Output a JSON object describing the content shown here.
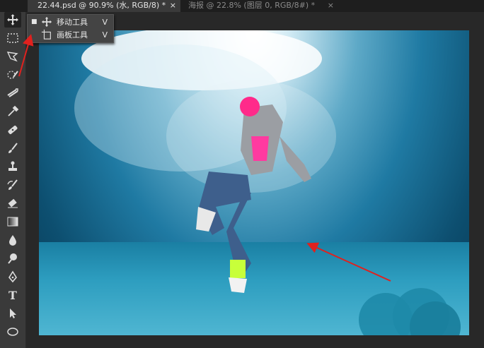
{
  "tabs": [
    {
      "title": "22.44.psd @ 90.9% (水, RGB/8) *",
      "close": "×",
      "active": true
    },
    {
      "title": "海报 @ 22.8% (图层 0, RGB/8#) *",
      "close": "×",
      "active": false
    }
  ],
  "tools": [
    {
      "name": "move-tool",
      "icon": "move-icon"
    },
    {
      "name": "marquee-tool",
      "icon": "rectangular-marquee-icon"
    },
    {
      "name": "lasso-tool",
      "icon": "polygonal-lasso-icon"
    },
    {
      "name": "quick-selection-tool",
      "icon": "quick-selection-icon"
    },
    {
      "name": "crop-tool",
      "icon": "crop-icon"
    },
    {
      "name": "eyedropper-tool",
      "icon": "eyedropper-icon"
    },
    {
      "name": "healing-brush-tool",
      "icon": "bandage-icon"
    },
    {
      "name": "brush-tool",
      "icon": "brush-icon"
    },
    {
      "name": "clone-stamp-tool",
      "icon": "stamp-icon"
    },
    {
      "name": "history-brush-tool",
      "icon": "history-brush-icon"
    },
    {
      "name": "eraser-tool",
      "icon": "eraser-icon"
    },
    {
      "name": "gradient-tool",
      "icon": "gradient-icon"
    },
    {
      "name": "blur-tool",
      "icon": "drop-icon"
    },
    {
      "name": "dodge-tool",
      "icon": "dodge-icon"
    },
    {
      "name": "pen-tool",
      "icon": "pen-icon"
    },
    {
      "name": "type-tool",
      "icon": "type-icon"
    },
    {
      "name": "path-selection-tool",
      "icon": "arrow-pointer-icon"
    },
    {
      "name": "shape-tool",
      "icon": "ellipse-icon"
    }
  ],
  "type_tool_glyph": "T",
  "flyout": {
    "items": [
      {
        "bullet": "■",
        "label": "移动工具",
        "shortcut": "V",
        "icon": "move-icon"
      },
      {
        "bullet": "",
        "label": "画板工具",
        "shortcut": "V",
        "icon": "artboard-icon"
      }
    ]
  },
  "colors": {
    "annotation_arrow": "#e0211e",
    "ui_dark": "#282828",
    "panel": "#3a3a3a"
  }
}
